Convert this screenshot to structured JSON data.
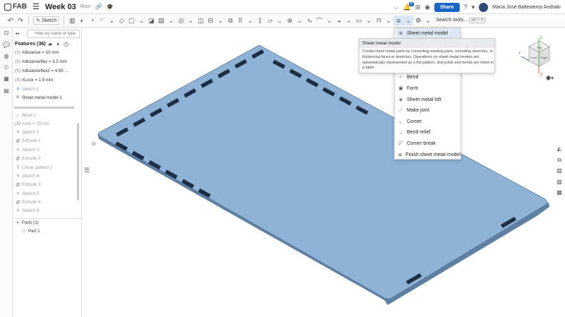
{
  "topbar": {
    "logo_text": "FAB",
    "doc_title": "Week 03",
    "branch": "Main",
    "share_label": "Share",
    "user_name": "María José Ballesteros Andrakı",
    "notif_count": "6"
  },
  "toolbar": {
    "sketch_label": "Sketch",
    "search_label": "Search tools...",
    "search_shortcut": "alt/⌥ C"
  },
  "features": {
    "filter_placeholder": "Filter by name or type",
    "header": "Features (36)",
    "items": [
      {
        "label": "#distance = 10 mm",
        "prefix": "(X)"
      },
      {
        "label": "#distanceflex = 3.5 mm",
        "prefix": "(X)"
      },
      {
        "label": "#distanceflex2 = 4.65 ...",
        "prefix": "(X)"
      },
      {
        "label": "#Lock = 1.5 mm",
        "prefix": "(X)"
      },
      {
        "label": "Sketch 1",
        "prefix": ""
      },
      {
        "label": "Sheet metal model 1",
        "prefix": ""
      }
    ],
    "rolled_items": [
      {
        "label": "Bend 1",
        "prefix": ""
      },
      {
        "label": "#slot = 70 mm",
        "prefix": "(X)"
      },
      {
        "label": "Sketch 2",
        "prefix": ""
      },
      {
        "label": "Extrude 1",
        "prefix": ""
      },
      {
        "label": "Sketch 3",
        "prefix": ""
      },
      {
        "label": "Extrude 2",
        "prefix": ""
      },
      {
        "label": "Linear pattern 1",
        "prefix": ""
      },
      {
        "label": "Sketch 4",
        "prefix": ""
      },
      {
        "label": "Extrude 3",
        "prefix": ""
      },
      {
        "label": "Sketch 5",
        "prefix": ""
      },
      {
        "label": "Extrude 4",
        "prefix": ""
      },
      {
        "label": "Sketch 8",
        "prefix": ""
      }
    ],
    "parts_header": "Parts (1)",
    "part_item": "Part 1"
  },
  "menu": {
    "items": [
      {
        "label": "Sheet metal model",
        "icon": "sheet-metal-icon"
      },
      {
        "label": "Bend",
        "icon": "bend-icon"
      },
      {
        "label": "Form",
        "icon": "form-icon"
      },
      {
        "label": "Sheet metal loft",
        "icon": "loft-icon"
      },
      {
        "label": "Make joint",
        "icon": "joint-icon"
      },
      {
        "label": "Corner",
        "icon": "corner-icon"
      },
      {
        "label": "Bend relief",
        "icon": "bend-relief-icon"
      },
      {
        "label": "Corner break",
        "icon": "corner-break-icon"
      },
      {
        "label": "Finish sheet metal model",
        "icon": "finish-icon"
      }
    ]
  },
  "tooltip": {
    "title": "Sheet metal model",
    "body": "Create sheet metal parts by converting existing parts, extruding sketches, or thickening faces or sketches. Operations on sheet metal models are automatically represented as a flat pattern, and joints and bends are listed in a table."
  },
  "viewcube": {
    "top_label": "Top",
    "front_label": "Front",
    "right_label": "Right",
    "axis_x": "X",
    "axis_y": "Y",
    "axis_z": "Z"
  },
  "colors": {
    "accent": "#1a66c6",
    "plate_top": "#8fb3d6",
    "plate_edge": "#6f8fb2",
    "slot": "#1e2e44"
  }
}
